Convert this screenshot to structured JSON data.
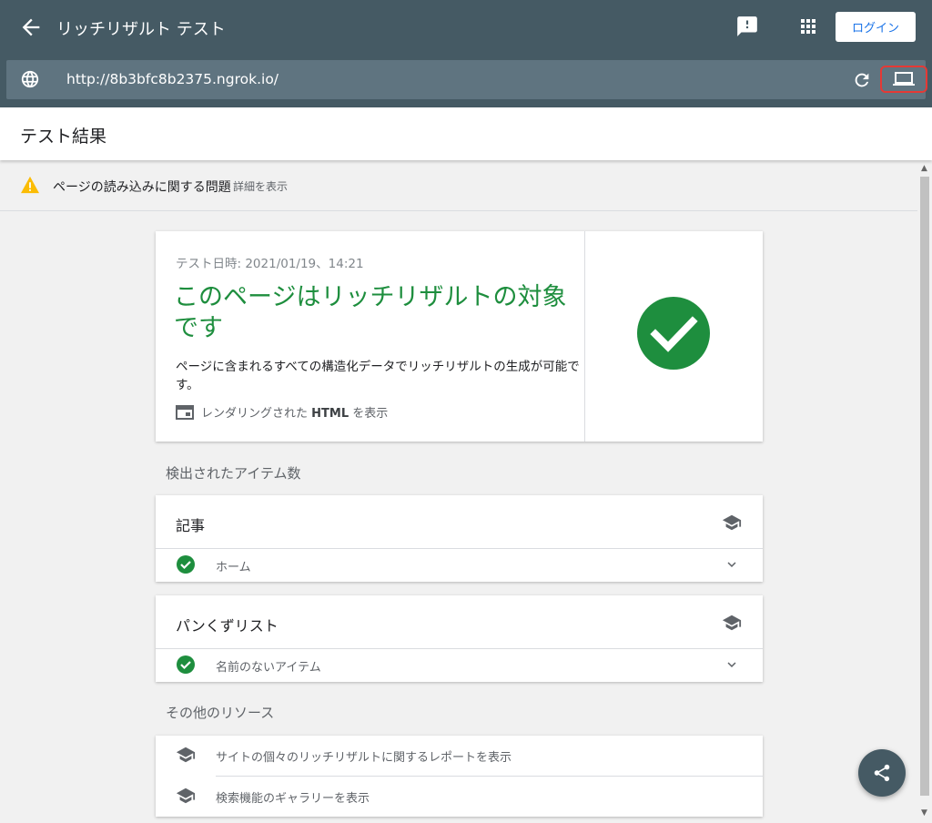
{
  "header": {
    "title": "リッチリザルト テスト",
    "login_label": "ログイン",
    "url": "http://8b3bfc8b2375.ngrok.io/"
  },
  "results": {
    "title": "テスト結果"
  },
  "warning": {
    "text": "ページの読み込みに関する問題",
    "link": "詳細を表示"
  },
  "summary": {
    "date": "テスト日時: 2021/01/19、14:21",
    "headline": "このページはリッチリザルトの対象です",
    "description": "ページに含まれるすべての構造化データでリッチリザルトの生成が可能です。",
    "render_link_prefix": "レンダリングされた ",
    "render_link_bold": "HTML",
    "render_link_suffix": " を表示"
  },
  "detected": {
    "label": "検出されたアイテム数",
    "items": [
      {
        "title": "記事",
        "row": "ホーム"
      },
      {
        "title": "パンくずリスト",
        "row": "名前のないアイテム"
      }
    ]
  },
  "resources": {
    "label": "その他のリソース",
    "links": [
      "サイトの個々のリッチリザルトに関するレポートを表示",
      "検索機能のギャラリーを表示"
    ]
  },
  "colors": {
    "header_bg": "#455a64",
    "urlbar_bg": "#5f7480",
    "success": "#1e8e3e",
    "warning": "#fbbc04",
    "highlight": "#e53935"
  },
  "icons": [
    "back-arrow-icon",
    "feedback-icon",
    "apps-grid-icon",
    "globe-icon",
    "reload-icon",
    "laptop-icon",
    "warning-icon",
    "check-circle-icon",
    "browser-window-icon",
    "graduation-cap-icon",
    "chevron-down-icon",
    "share-icon"
  ]
}
